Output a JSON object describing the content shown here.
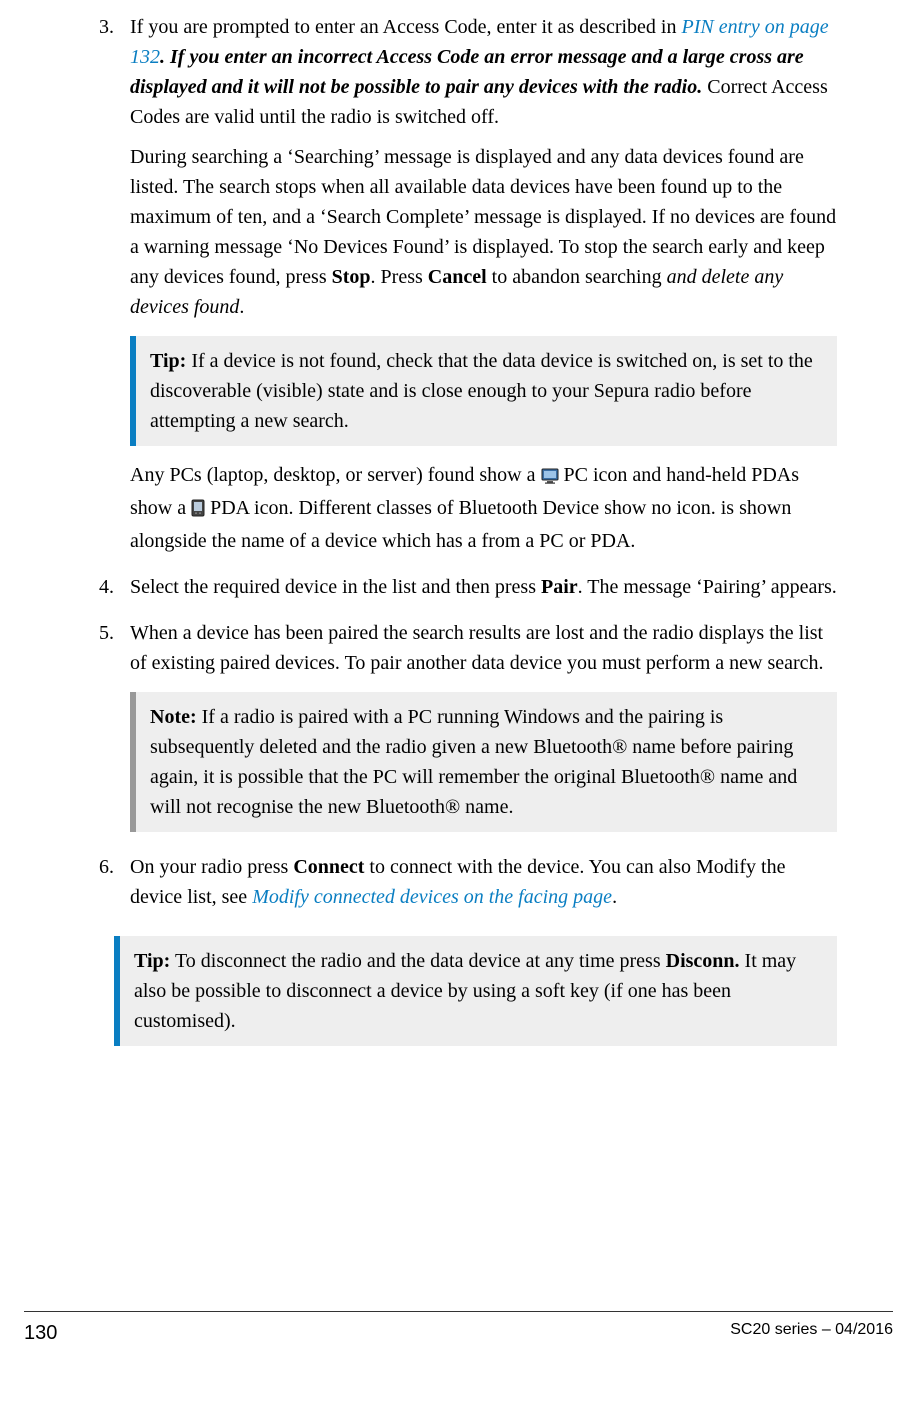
{
  "steps": {
    "s3": {
      "num": "3.",
      "p1_a": "If you are prompted to enter an Access Code, enter it as described in ",
      "p1_link": "PIN entry on page 132",
      "p1_b": ". ",
      "p1_bi": "If you enter an incorrect Access Code an error message and a large cross are displayed and it will not be possible to pair any devices with the radio.",
      "p1_c": " Correct Access Codes are valid until the radio is switched off.",
      "p2_a": "During searching a ‘Searching’ message is displayed and any data devices found are listed. The search stops when all available data devices have been found up to the maximum of ten, and a ‘Search Complete’ message is displayed. If no devices are found a warning message ‘No Devices Found’ is displayed. To stop the search early and keep any devices found, press ",
      "p2_b1": "Stop",
      "p2_b": ". Press ",
      "p2_b2": "Cancel",
      "p2_c": " to abandon searching ",
      "p2_i": "and delete any devices found",
      "p2_d": ".",
      "tip_label": "Tip:",
      "tip_body": "  If a device is not found, check that the data device is switched on, is set to the discoverable (visible) state and is close enough to your Sepura radio before attempting a new search.",
      "p3_a": "Any PCs (laptop, desktop, or server) found show a ",
      "p3_b": " PC icon and hand-held PDAs show a ",
      "p3_c": " PDA icon. Different classes of Bluetooth Device show no icon. is shown alongside the name of a device which has a from a PC or PDA."
    },
    "s4": {
      "num": "4.",
      "p_a": "Select the required device in the list and then press ",
      "p_b": "Pair",
      "p_c": ". The message ‘Pairing’ appears."
    },
    "s5": {
      "num": "5.",
      "p": "When a device has been paired the search results are lost and the radio displays the list of existing paired devices. To pair another data device you must perform a new search.",
      "note_label": "Note:",
      "note_body": "  If a radio is paired with a PC running Windows and the pairing is subsequently deleted and the radio given a new Bluetooth® name before pairing again, it is possible that the PC will remember the original Bluetooth® name and will not recognise the new Bluetooth® name."
    },
    "s6": {
      "num": "6.",
      "p_a": "On your radio press ",
      "p_b": "Connect",
      "p_c": " to connect with the device. You can also Modify the device list, see ",
      "p_link": "Modify connected devices on the facing page",
      "p_d": ".",
      "tip_label": "Tip:",
      "tip_a": "  To disconnect the radio and the data device at any time press ",
      "tip_b": "Disconn.",
      "tip_c": " It may also be possible to disconnect a device by using a soft key (if one has been customised)."
    }
  },
  "footer": {
    "page_num": "130",
    "doc_id": "SC20 series – 04/2016"
  }
}
